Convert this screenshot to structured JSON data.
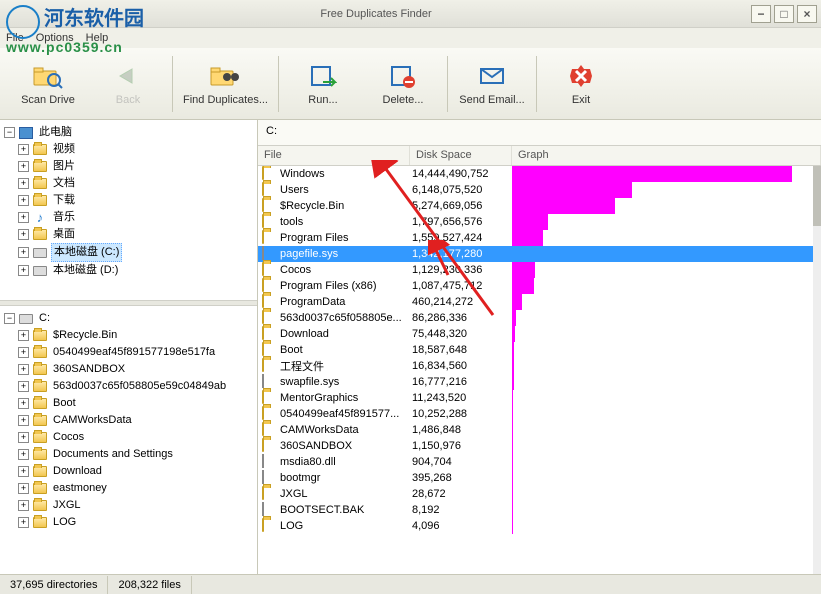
{
  "window": {
    "title": "Free Duplicates Finder"
  },
  "watermark": {
    "line1": "河东软件园",
    "line2": "www.pc0359.cn"
  },
  "menubar": {
    "file": "File",
    "options": "Options",
    "help": "Help"
  },
  "toolbar": {
    "scan": "Scan Drive",
    "back": "Back",
    "find": "Find Duplicates...",
    "run": "Run...",
    "delete": "Delete...",
    "email": "Send Email...",
    "exit": "Exit"
  },
  "tree_top": {
    "root": "此电脑",
    "items": [
      {
        "label": "视频",
        "icon": "video"
      },
      {
        "label": "图片",
        "icon": "picture"
      },
      {
        "label": "文档",
        "icon": "doc"
      },
      {
        "label": "下载",
        "icon": "download"
      },
      {
        "label": "音乐",
        "icon": "music"
      },
      {
        "label": "桌面",
        "icon": "desktop"
      },
      {
        "label": "本地磁盘 (C:)",
        "icon": "drive",
        "sel": true
      },
      {
        "label": "本地磁盘 (D:)",
        "icon": "drive"
      }
    ]
  },
  "tree_bottom": {
    "root": "C:",
    "items": [
      "$Recycle.Bin",
      "0540499eaf45f891577198e517fa",
      "360SANDBOX",
      "563d0037c65f058805e59c04849ab",
      "Boot",
      "CAMWorksData",
      "Cocos",
      "Documents and Settings",
      "Download",
      "eastmoney",
      "JXGL",
      "LOG"
    ]
  },
  "list": {
    "path": "C:",
    "headers": {
      "file": "File",
      "disk": "Disk Space",
      "graph": "Graph"
    },
    "rows": [
      {
        "name": "Windows",
        "size": "14,444,490,752",
        "type": "folder",
        "bar": 280
      },
      {
        "name": "Users",
        "size": "6,148,075,520",
        "type": "folder",
        "bar": 120
      },
      {
        "name": "$Recycle.Bin",
        "size": "5,274,669,056",
        "type": "folder",
        "bar": 103
      },
      {
        "name": "tools",
        "size": "1,797,656,576",
        "type": "folder",
        "bar": 36
      },
      {
        "name": "Program Files",
        "size": "1,559,527,424",
        "type": "folder",
        "bar": 31
      },
      {
        "name": "pagefile.sys",
        "size": "1,342,177,280",
        "type": "file",
        "bar": 540,
        "sel": true
      },
      {
        "name": "Cocos",
        "size": "1,129,230,336",
        "type": "folder",
        "bar": 23
      },
      {
        "name": "Program Files (x86)",
        "size": "1,087,475,712",
        "type": "folder",
        "bar": 22
      },
      {
        "name": "ProgramData",
        "size": "460,214,272",
        "type": "folder",
        "bar": 10
      },
      {
        "name": "563d0037c65f058805e...",
        "size": "86,286,336",
        "type": "folder",
        "bar": 4
      },
      {
        "name": "Download",
        "size": "75,448,320",
        "type": "folder",
        "bar": 3
      },
      {
        "name": "Boot",
        "size": "18,587,648",
        "type": "folder",
        "bar": 2
      },
      {
        "name": "工程文件",
        "size": "16,834,560",
        "type": "folder",
        "bar": 2
      },
      {
        "name": "swapfile.sys",
        "size": "16,777,216",
        "type": "file",
        "bar": 2
      },
      {
        "name": "MentorGraphics",
        "size": "11,243,520",
        "type": "folder",
        "bar": 1
      },
      {
        "name": "0540499eaf45f891577...",
        "size": "10,252,288",
        "type": "folder",
        "bar": 1
      },
      {
        "name": "CAMWorksData",
        "size": "1,486,848",
        "type": "folder",
        "bar": 1
      },
      {
        "name": "360SANDBOX",
        "size": "1,150,976",
        "type": "folder",
        "bar": 1
      },
      {
        "name": "msdia80.dll",
        "size": "904,704",
        "type": "file",
        "bar": 1
      },
      {
        "name": "bootmgr",
        "size": "395,268",
        "type": "file",
        "bar": 1
      },
      {
        "name": "JXGL",
        "size": "28,672",
        "type": "folder",
        "bar": 1
      },
      {
        "name": "BOOTSECT.BAK",
        "size": "8,192",
        "type": "file",
        "bar": 1
      },
      {
        "name": "LOG",
        "size": "4,096",
        "type": "folder",
        "bar": 1
      }
    ]
  },
  "status": {
    "dirs": "37,695 directories",
    "files": "208,322 files"
  }
}
